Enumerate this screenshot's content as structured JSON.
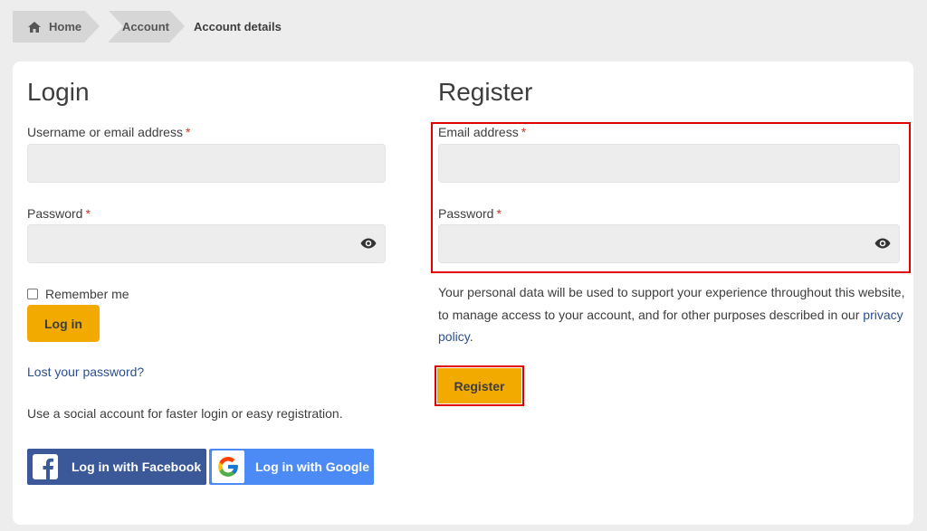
{
  "breadcrumb": {
    "home": "Home",
    "account": "Account",
    "current": "Account details"
  },
  "login": {
    "title": "Login",
    "username_label": "Username or email address",
    "username_value": "",
    "password_label": "Password",
    "password_value": "",
    "required_marker": "*",
    "remember_label": "Remember me",
    "remember_checked": false,
    "submit_label": "Log in",
    "lost_password_link": "Lost your password?",
    "social_text": "Use a social account for faster login or easy registration.",
    "facebook_label": "Log in with Facebook",
    "google_label": "Log in with Google"
  },
  "register": {
    "title": "Register",
    "email_label": "Email address",
    "email_value": "",
    "password_label": "Password",
    "password_value": "",
    "required_marker": "*",
    "privacy_before": "Your personal data will be used to support your experience throughout this website, to manage access to your account, and for other purposes described in our ",
    "privacy_link": "privacy policy",
    "privacy_after": ".",
    "submit_label": "Register"
  },
  "colors": {
    "accent": "#f2a900",
    "link": "#2b4f8f",
    "required": "#d9332b",
    "highlight": "#e00000",
    "facebook": "#3b5998",
    "google": "#4c8bf5"
  }
}
